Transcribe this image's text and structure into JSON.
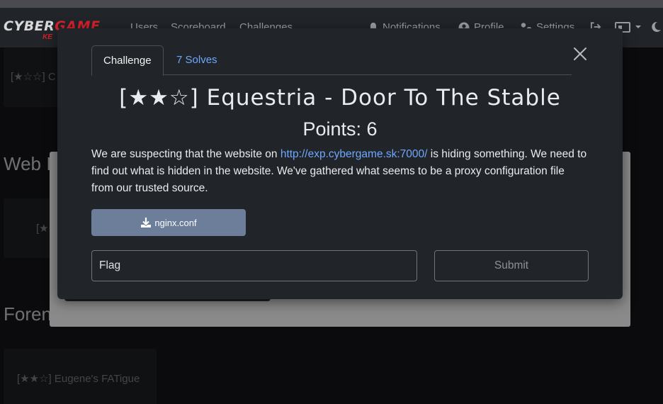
{
  "navbar": {
    "logo_primary": "CYBER",
    "logo_secondary": "GAME",
    "logo_sub": "KE",
    "links": [
      "Users",
      "Scoreboard",
      "Challenges"
    ],
    "right": {
      "notifications": "Notifications",
      "profile": "Profile",
      "settings": "Settings"
    }
  },
  "background": {
    "card_top": "[★☆☆] C",
    "section_web": "Web I",
    "card_web": "[★",
    "section_forensics": "Foren",
    "card_forensics": "[★★☆] Eugene's FATigue"
  },
  "modal": {
    "tabs": {
      "challenge": "Challenge",
      "solves": "7 Solves"
    },
    "title": "[★★☆] Equestria - Door To The Stable",
    "points": "Points: 6",
    "description": {
      "before_link": "We are suspecting that the website on ",
      "link": "http://exp.cybergame.sk:7000/",
      "after_link": " is hiding something. We need to find out what is hidden in the website. We've gathered what seems to be a proxy configuration file from our trusted source."
    },
    "file_button": "nginx.conf",
    "flag_placeholder": "Flag",
    "submit_label": "Submit"
  },
  "colors": {
    "accent_link": "#6ea8fe",
    "brand_red": "#d6202c",
    "download_button": "#6c7e9a"
  },
  "icons": [
    "bell-icon",
    "user-circle-icon",
    "user-gear-icon",
    "logout-icon",
    "language-icon",
    "moon-icon",
    "close-icon",
    "download-icon"
  ]
}
